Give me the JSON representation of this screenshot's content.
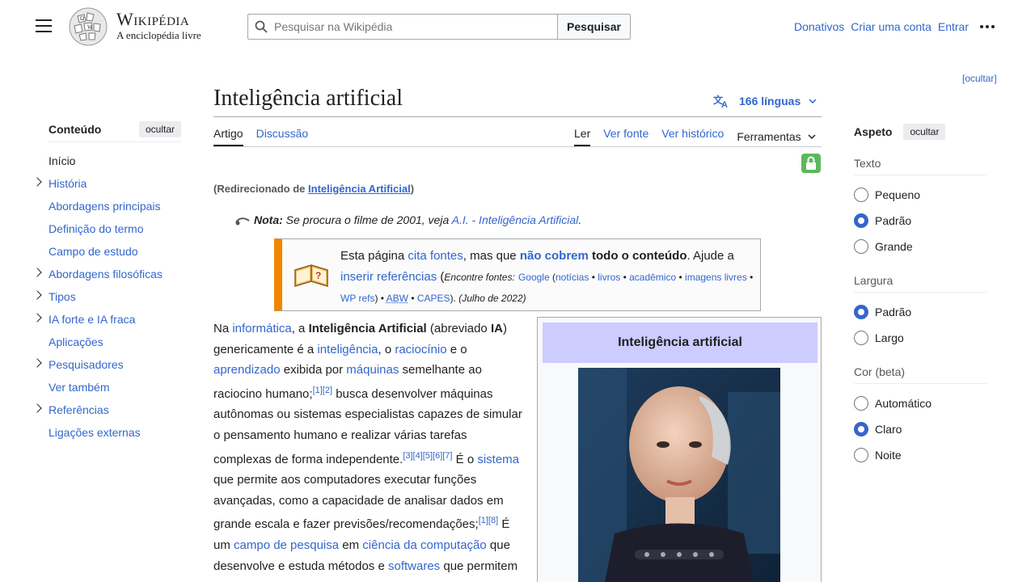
{
  "header": {
    "wordmark_title": "Wikipédia",
    "wordmark_tagline": "A enciclopédia livre",
    "search_placeholder": "Pesquisar na Wikipédia",
    "search_button": "Pesquisar",
    "links": [
      "Donativos",
      "Criar uma conta",
      "Entrar"
    ]
  },
  "hide_top": "[ocultar]",
  "toc": {
    "title": "Conteúdo",
    "hide": "ocultar",
    "items": [
      {
        "label": "Início",
        "expandable": false
      },
      {
        "label": "História",
        "expandable": true
      },
      {
        "label": "Abordagens principais",
        "expandable": false
      },
      {
        "label": "Definição do termo",
        "expandable": false
      },
      {
        "label": "Campo de estudo",
        "expandable": false
      },
      {
        "label": "Abordagens filosóficas",
        "expandable": true
      },
      {
        "label": "Tipos",
        "expandable": true
      },
      {
        "label": "IA forte e IA fraca",
        "expandable": true
      },
      {
        "label": "Aplicações",
        "expandable": false
      },
      {
        "label": "Pesquisadores",
        "expandable": true
      },
      {
        "label": "Ver também",
        "expandable": false
      },
      {
        "label": "Referências",
        "expandable": true
      },
      {
        "label": "Ligações externas",
        "expandable": false
      }
    ]
  },
  "article": {
    "title": "Inteligência artificial",
    "languages": "166 línguas",
    "tabs_left": [
      "Artigo",
      "Discussão"
    ],
    "tabs_right": [
      "Ler",
      "Ver fonte",
      "Ver histórico",
      "Ferramentas"
    ],
    "redirect_prefix": "(Redirecionado de ",
    "redirect_link": "Inteligência Artificial",
    "redirect_suffix": ")",
    "hatnote_label": "Nota:",
    "hatnote_text": " Se procura o filme de 2001, veja ",
    "hatnote_link": "A.I. - Inteligência Artificial",
    "ambox": {
      "t1": "Esta página ",
      "l1": "cita fontes",
      "t2": ", mas que ",
      "l2": "não cobrem",
      "t3": " todo o conteúdo",
      "t4": ". Ajude a ",
      "l3": "inserir referências",
      "t5": " (",
      "find": "Encontre fontes:",
      "sources": [
        "Google",
        "notícias",
        "livros",
        "acadêmico",
        "imagens livres",
        "WP refs",
        "ABW",
        "CAPES"
      ],
      "date": "(Julho de 2022)"
    }
  },
  "infobox": {
    "title": "Inteligência artificial"
  },
  "aspect": {
    "title": "Aspeto",
    "hide": "ocultar",
    "groups": [
      {
        "label": "Texto",
        "options": [
          "Pequeno",
          "Padrão",
          "Grande"
        ],
        "selected": 1
      },
      {
        "label": "Largura",
        "options": [
          "Padrão",
          "Largo"
        ],
        "selected": 0
      },
      {
        "label": "Cor (beta)",
        "options": [
          "Automático",
          "Claro",
          "Noite"
        ],
        "selected": 1
      }
    ]
  }
}
